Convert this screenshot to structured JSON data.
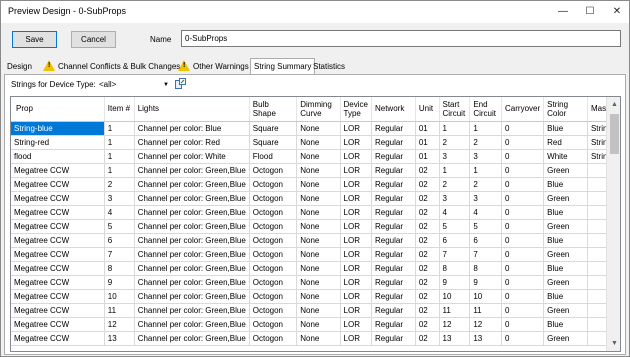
{
  "window": {
    "title": "Preview Design - 0-SubProps",
    "min": "—",
    "max": "☐",
    "close": "✕"
  },
  "toolbar": {
    "save_label": "Save",
    "cancel_label": "Cancel",
    "name_label": "Name",
    "name_value": "0-SubProps"
  },
  "tabs": [
    {
      "label": "Design",
      "warning": false
    },
    {
      "label": "Channel Conflicts & Bulk Changes",
      "warning": true
    },
    {
      "label": "Other Warnings",
      "warning": true
    },
    {
      "label": "String Summary",
      "warning": false,
      "active": true
    },
    {
      "label": "Statistics",
      "warning": false
    }
  ],
  "filter": {
    "label": "Strings for Device Type:",
    "value": "<all>"
  },
  "table": {
    "headers": [
      "Prop",
      "Item #",
      "Lights",
      "Bulb Shape",
      "Dimming Curve",
      "Device Type",
      "Network",
      "Unit",
      "Start Circuit",
      "End Circuit",
      "Carryover",
      "String Color",
      "Master"
    ],
    "rows": [
      [
        "String-blue",
        "1",
        "Channel per color: Blue",
        "Square",
        "None",
        "LOR",
        "Regular",
        "01",
        "1",
        "1",
        "0",
        "Blue",
        "Strings"
      ],
      [
        "String-red",
        "1",
        "Channel per color: Red",
        "Square",
        "None",
        "LOR",
        "Regular",
        "01",
        "2",
        "2",
        "0",
        "Red",
        "Strings"
      ],
      [
        "flood",
        "1",
        "Channel per color: White",
        "Flood",
        "None",
        "LOR",
        "Regular",
        "01",
        "3",
        "3",
        "0",
        "White",
        "Strings"
      ],
      [
        "Megatree CCW",
        "1",
        "Channel per color: Green,Blue",
        "Octogon",
        "None",
        "LOR",
        "Regular",
        "02",
        "1",
        "1",
        "0",
        "Green",
        ""
      ],
      [
        "Megatree CCW",
        "2",
        "Channel per color: Green,Blue",
        "Octogon",
        "None",
        "LOR",
        "Regular",
        "02",
        "2",
        "2",
        "0",
        "Blue",
        ""
      ],
      [
        "Megatree CCW",
        "3",
        "Channel per color: Green,Blue",
        "Octogon",
        "None",
        "LOR",
        "Regular",
        "02",
        "3",
        "3",
        "0",
        "Green",
        ""
      ],
      [
        "Megatree CCW",
        "4",
        "Channel per color: Green,Blue",
        "Octogon",
        "None",
        "LOR",
        "Regular",
        "02",
        "4",
        "4",
        "0",
        "Blue",
        ""
      ],
      [
        "Megatree CCW",
        "5",
        "Channel per color: Green,Blue",
        "Octogon",
        "None",
        "LOR",
        "Regular",
        "02",
        "5",
        "5",
        "0",
        "Green",
        ""
      ],
      [
        "Megatree CCW",
        "6",
        "Channel per color: Green,Blue",
        "Octogon",
        "None",
        "LOR",
        "Regular",
        "02",
        "6",
        "6",
        "0",
        "Blue",
        ""
      ],
      [
        "Megatree CCW",
        "7",
        "Channel per color: Green,Blue",
        "Octogon",
        "None",
        "LOR",
        "Regular",
        "02",
        "7",
        "7",
        "0",
        "Green",
        ""
      ],
      [
        "Megatree CCW",
        "8",
        "Channel per color: Green,Blue",
        "Octogon",
        "None",
        "LOR",
        "Regular",
        "02",
        "8",
        "8",
        "0",
        "Blue",
        ""
      ],
      [
        "Megatree CCW",
        "9",
        "Channel per color: Green,Blue",
        "Octogon",
        "None",
        "LOR",
        "Regular",
        "02",
        "9",
        "9",
        "0",
        "Green",
        ""
      ],
      [
        "Megatree CCW",
        "10",
        "Channel per color: Green,Blue",
        "Octogon",
        "None",
        "LOR",
        "Regular",
        "02",
        "10",
        "10",
        "0",
        "Blue",
        ""
      ],
      [
        "Megatree CCW",
        "11",
        "Channel per color: Green,Blue",
        "Octogon",
        "None",
        "LOR",
        "Regular",
        "02",
        "11",
        "11",
        "0",
        "Green",
        ""
      ],
      [
        "Megatree CCW",
        "12",
        "Channel per color: Green,Blue",
        "Octogon",
        "None",
        "LOR",
        "Regular",
        "02",
        "12",
        "12",
        "0",
        "Blue",
        ""
      ],
      [
        "Megatree CCW",
        "13",
        "Channel per color: Green,Blue",
        "Octogon",
        "None",
        "LOR",
        "Regular",
        "02",
        "13",
        "13",
        "0",
        "Green",
        ""
      ]
    ]
  },
  "colors": {
    "selection": "#0078d7",
    "warning": "#f2c200"
  },
  "icons": {
    "filter_tool": "export-icon",
    "warning": "warning-icon"
  }
}
